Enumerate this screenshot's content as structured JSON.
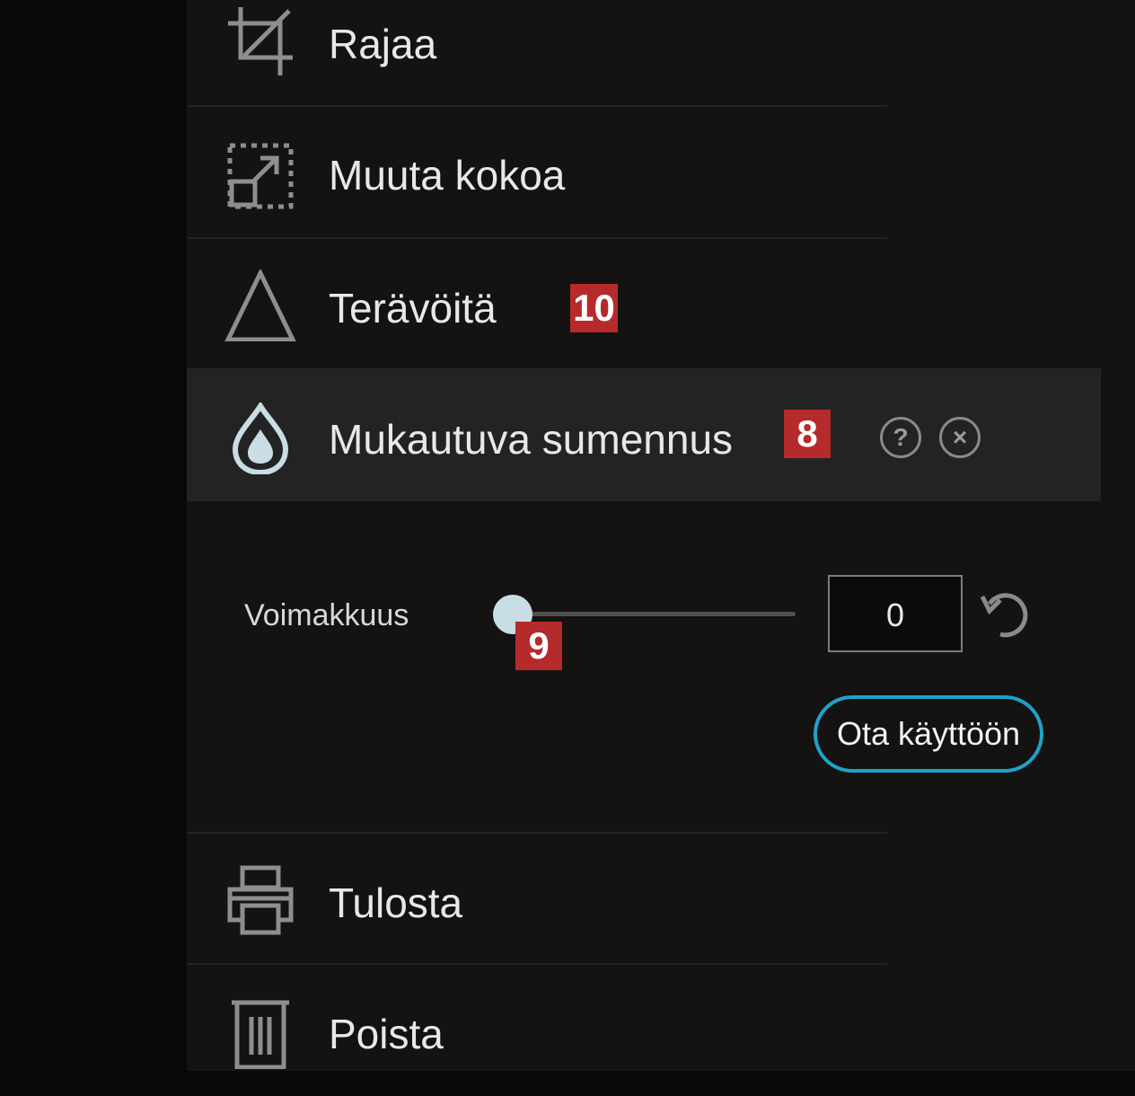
{
  "menu": {
    "crop_label": "Rajaa",
    "resize_label": "Muuta kokoa",
    "sharpen_label": "Terävöitä",
    "blur_label": "Mukautuva sumennus",
    "print_label": "Tulosta",
    "delete_label": "Poista"
  },
  "blur_panel": {
    "strength_label": "Voimakkuus",
    "strength_value": "0",
    "strength_fraction": 0,
    "apply_label": "Ota käyttöön",
    "help_symbol": "?",
    "close_symbol": "×"
  },
  "callouts": {
    "sharpen": "10",
    "blur": "8",
    "slider": "9"
  },
  "colors": {
    "accent": "#1ea3c8",
    "badge": "#b52b2b",
    "panel": "#141312",
    "active_row": "#232324"
  },
  "icons": [
    "crop-icon",
    "resize-icon",
    "triangle-icon",
    "droplet-icon",
    "help-icon",
    "close-icon",
    "reset-icon",
    "printer-icon",
    "trash-icon"
  ]
}
